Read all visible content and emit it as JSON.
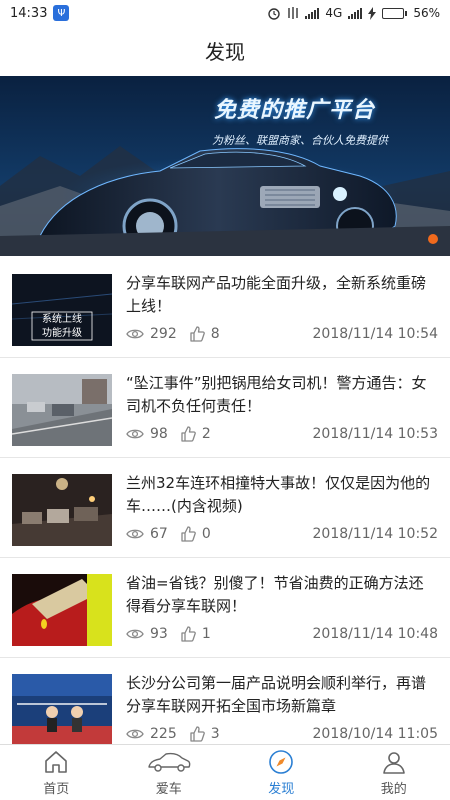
{
  "status_bar": {
    "time": "14:33",
    "network": "4G",
    "battery": "56%",
    "battery_level": 0.56
  },
  "header": {
    "title": "发现"
  },
  "banner": {
    "title": "免费的推广平台",
    "subtitle": "为粉丝、联盟商家、合伙人免费提供"
  },
  "news": [
    {
      "title": "分享车联网产品功能全面升级，全新系统重磅上线！",
      "views": "292",
      "likes": "8",
      "date": "2018/11/14 10:54",
      "thumb_text": [
        "系统上线",
        "功能升级"
      ]
    },
    {
      "title": "“坠江事件”别把锅甩给女司机！警方通告：女司机不负任何责任！",
      "views": "98",
      "likes": "2",
      "date": "2018/11/14 10:53"
    },
    {
      "title": "兰州32车连环相撞特大事故！仅仅是因为他的车……(内含视频)",
      "views": "67",
      "likes": "0",
      "date": "2018/11/14 10:52"
    },
    {
      "title": "省油=省钱？别傻了！节省油费的正确方法还得看分享车联网！",
      "views": "93",
      "likes": "1",
      "date": "2018/11/14 10:48"
    },
    {
      "title": "长沙分公司第一届产品说明会顺利举行，再谱分享车联网开拓全国市场新篇章",
      "views": "225",
      "likes": "3",
      "date": "2018/10/14 11:05"
    }
  ],
  "tabs": [
    {
      "label": "首页",
      "icon": "home-icon"
    },
    {
      "label": "爱车",
      "icon": "car-icon"
    },
    {
      "label": "发现",
      "icon": "compass-icon"
    },
    {
      "label": "我的",
      "icon": "user-icon"
    }
  ],
  "colors": {
    "accent": "#2b7fd3",
    "banner_dot": "#f06a1d",
    "battery": "#2db34a"
  }
}
